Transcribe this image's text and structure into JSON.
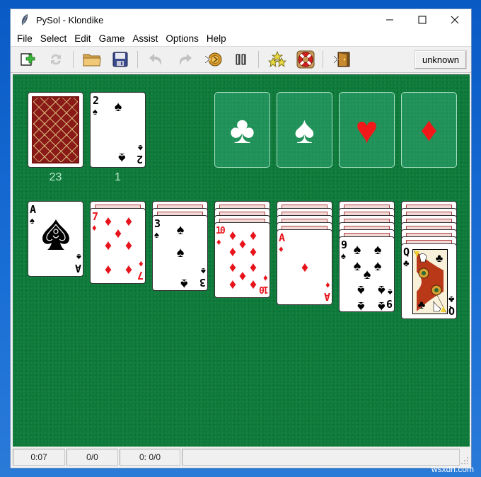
{
  "window": {
    "title": "PySol - Klondike",
    "controls": {
      "minimize": "minimize",
      "maximize": "maximize",
      "close": "close"
    }
  },
  "menu": [
    "File",
    "Select",
    "Edit",
    "Game",
    "Assist",
    "Options",
    "Help"
  ],
  "toolbar": {
    "buttons": [
      {
        "name": "new-game",
        "icon": "new-game-icon",
        "enabled": true
      },
      {
        "name": "restart",
        "icon": "restart-icon",
        "enabled": false
      },
      {
        "name": "open",
        "icon": "folder-icon",
        "enabled": true
      },
      {
        "name": "save",
        "icon": "floppy-icon",
        "enabled": true
      },
      {
        "name": "undo",
        "icon": "undo-icon",
        "enabled": false
      },
      {
        "name": "redo",
        "icon": "redo-icon",
        "enabled": false
      },
      {
        "name": "autodrop",
        "icon": "autodrop-icon",
        "enabled": true
      },
      {
        "name": "pause",
        "icon": "pause-icon",
        "enabled": true
      },
      {
        "name": "statistics",
        "icon": "stars-icon",
        "enabled": true
      },
      {
        "name": "rules",
        "icon": "lifebuoy-icon",
        "enabled": true
      },
      {
        "name": "quit",
        "icon": "exit-door-icon",
        "enabled": true
      }
    ],
    "player_label": "unknown"
  },
  "game": {
    "stock": {
      "count": "23",
      "face": "back"
    },
    "waste": {
      "count": "1",
      "top_card": {
        "rank": "2",
        "suit": "♠",
        "color": "black"
      }
    },
    "foundations": [
      {
        "suit": "♣",
        "color": "white"
      },
      {
        "suit": "♠",
        "color": "white"
      },
      {
        "suit": "♥",
        "color": "red"
      },
      {
        "suit": "♦",
        "color": "red"
      }
    ],
    "tableau": [
      {
        "hidden": 0,
        "top_card": {
          "rank": "A",
          "suit": "♠",
          "color": "black"
        }
      },
      {
        "hidden": 1,
        "top_card": {
          "rank": "7",
          "suit": "♦",
          "color": "red"
        }
      },
      {
        "hidden": 2,
        "top_card": {
          "rank": "3",
          "suit": "♠",
          "color": "black"
        }
      },
      {
        "hidden": 3,
        "top_card": {
          "rank": "10",
          "suit": "♦",
          "color": "red"
        }
      },
      {
        "hidden": 4,
        "top_card": {
          "rank": "A",
          "suit": "♦",
          "color": "red"
        }
      },
      {
        "hidden": 5,
        "top_card": {
          "rank": "9",
          "suit": "♠",
          "color": "black"
        }
      },
      {
        "hidden": 6,
        "top_card": {
          "rank": "Q",
          "suit": "♣",
          "color": "black"
        }
      }
    ]
  },
  "status": {
    "time": "0:07",
    "moves": "0/0",
    "score": "0: 0/0",
    "message": ""
  },
  "watermark": "wsxdn.com"
}
